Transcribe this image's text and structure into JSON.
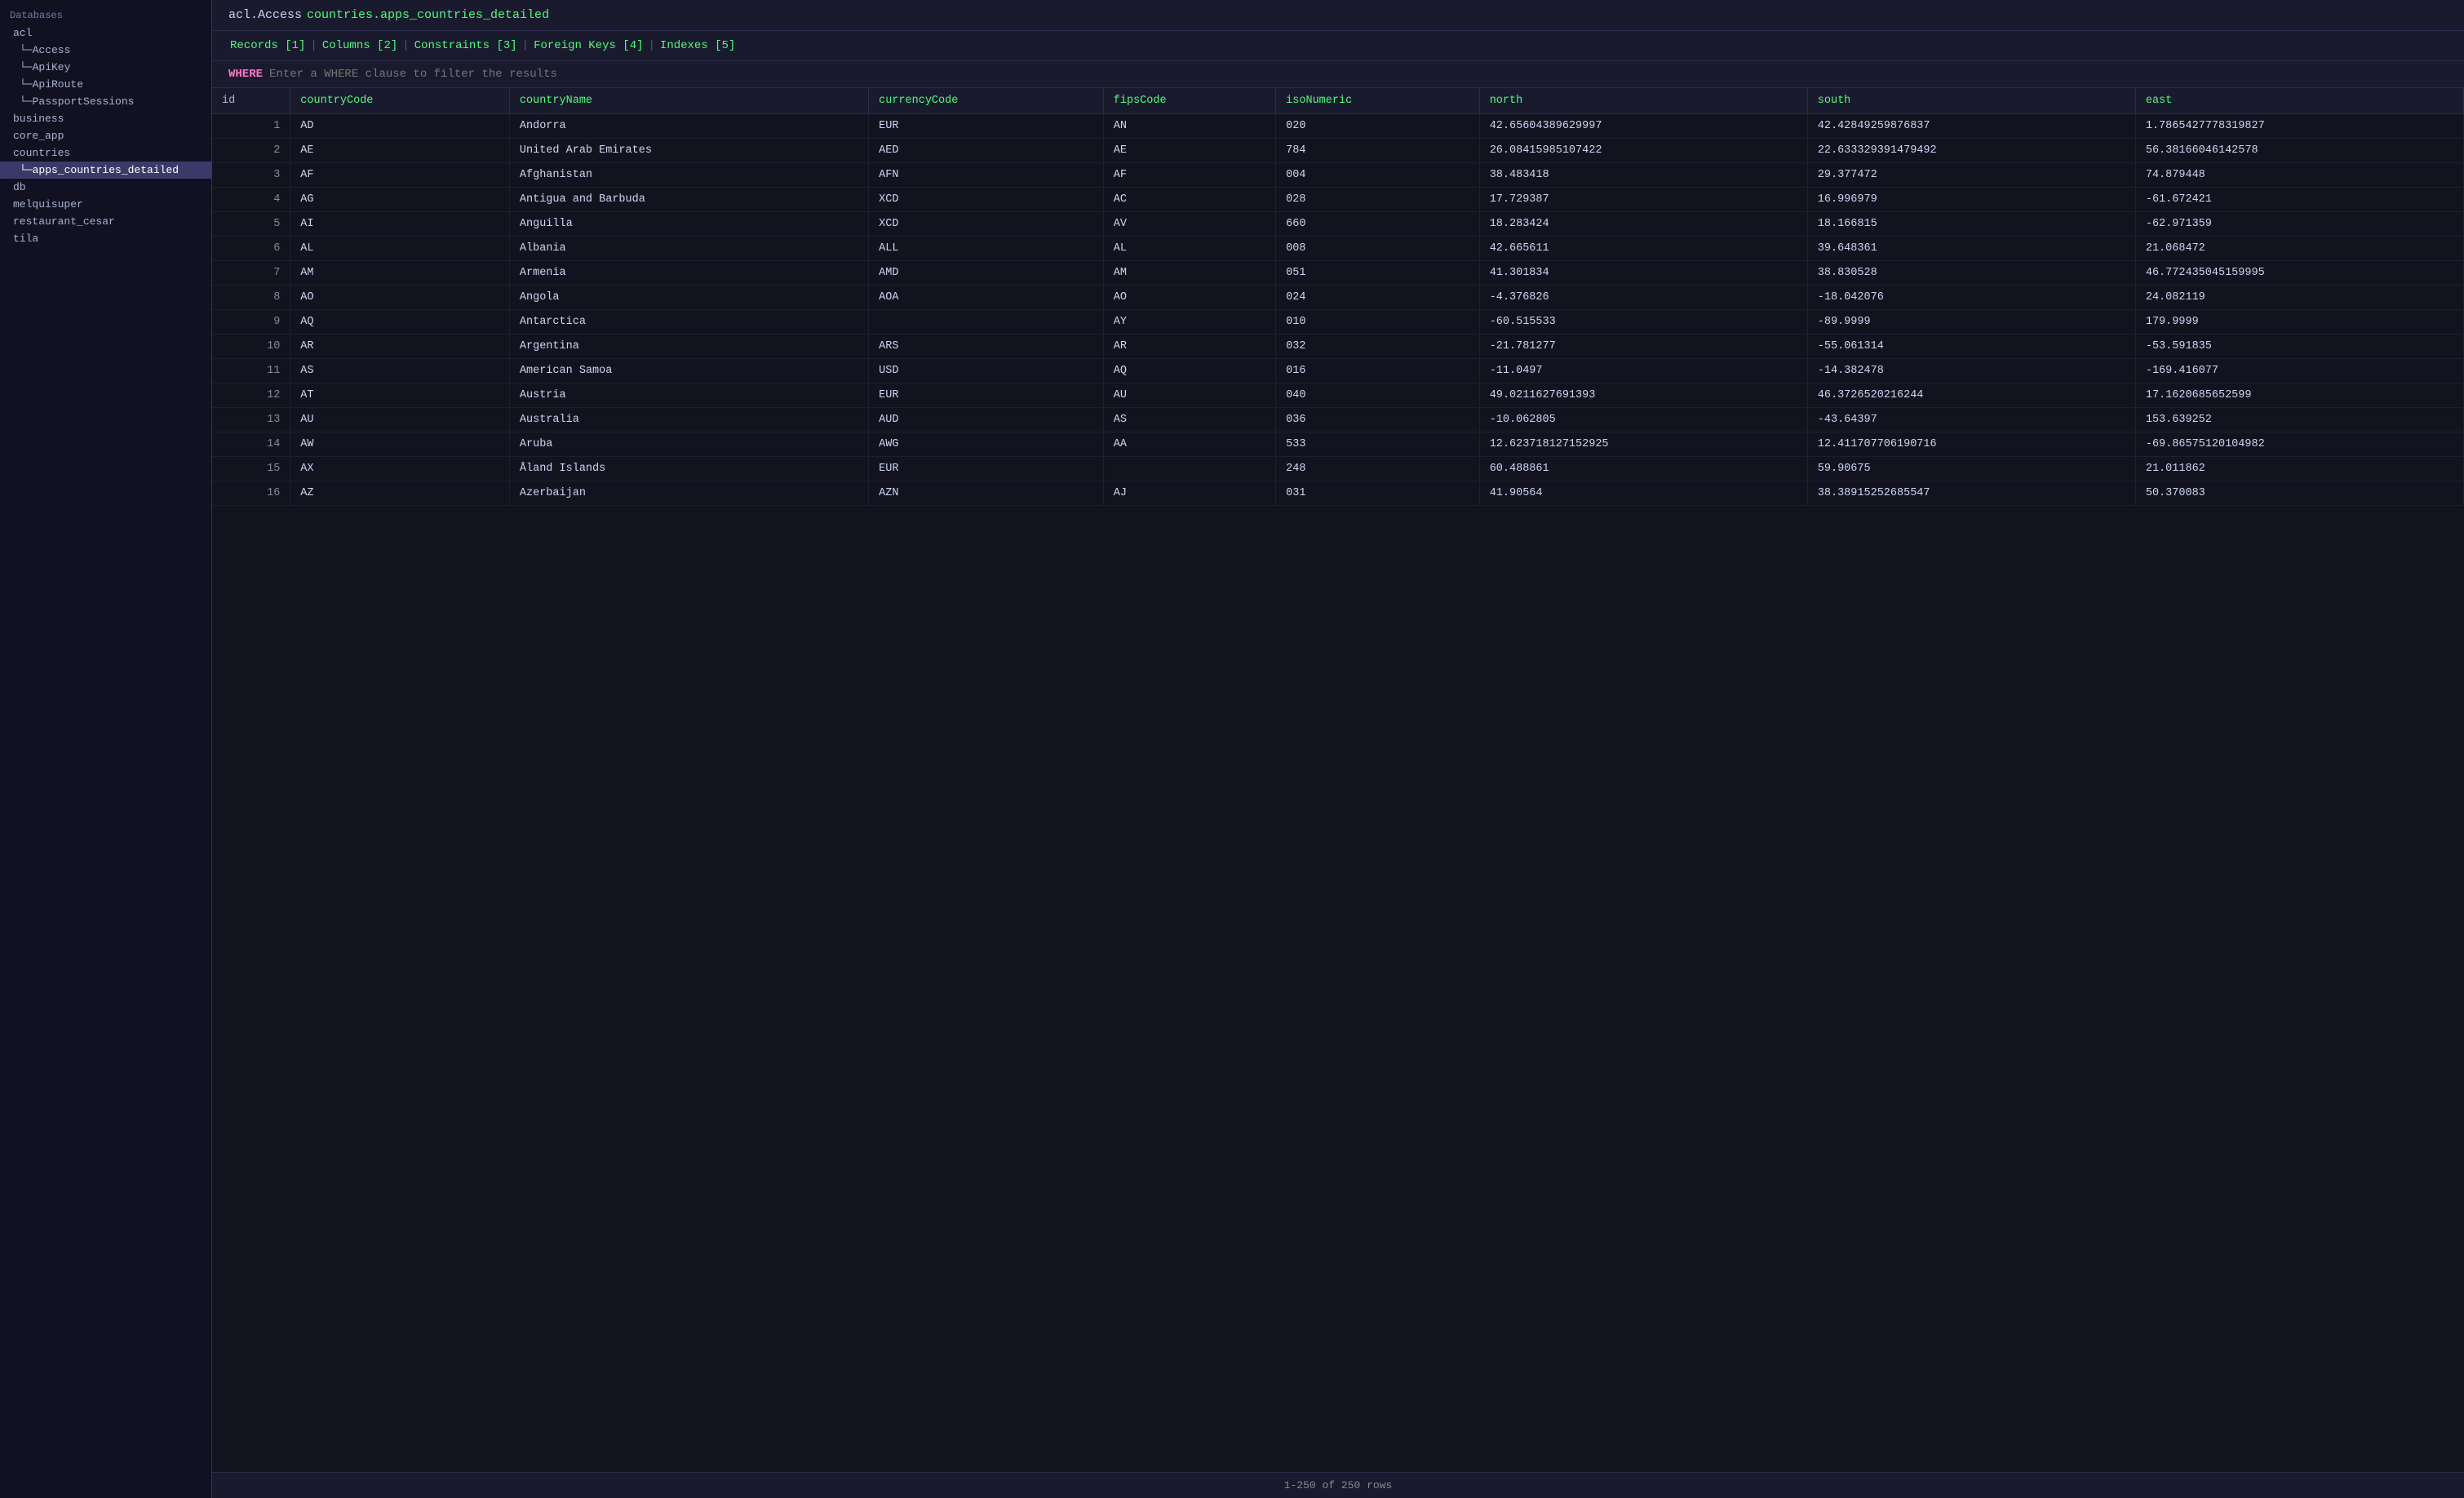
{
  "sidebar": {
    "title": "Databases",
    "items": [
      {
        "label": "acl",
        "level": 0,
        "selected": false
      },
      {
        "label": "Access",
        "level": 1,
        "selected": false
      },
      {
        "label": "ApiKey",
        "level": 1,
        "selected": false
      },
      {
        "label": "ApiRoute",
        "level": 1,
        "selected": false
      },
      {
        "label": "PassportSessions",
        "level": 1,
        "selected": false
      },
      {
        "label": "business",
        "level": 0,
        "selected": false
      },
      {
        "label": "core_app",
        "level": 0,
        "selected": false
      },
      {
        "label": "countries",
        "level": 0,
        "selected": false
      },
      {
        "label": "apps_countries_detailed",
        "level": 1,
        "selected": true
      },
      {
        "label": "db",
        "level": 0,
        "selected": false
      },
      {
        "label": "melquisuper",
        "level": 0,
        "selected": false
      },
      {
        "label": "restaurant_cesar",
        "level": 0,
        "selected": false
      },
      {
        "label": "tila",
        "level": 0,
        "selected": false
      }
    ]
  },
  "breadcrumb": {
    "schema": "acl.Access",
    "table": "countries.apps_countries_detailed"
  },
  "tabs": [
    {
      "label": "Records",
      "number": "1",
      "active": true
    },
    {
      "label": "Columns",
      "number": "2",
      "active": false
    },
    {
      "label": "Constraints",
      "number": "3",
      "active": false
    },
    {
      "label": "Foreign Keys",
      "number": "4",
      "active": false
    },
    {
      "label": "Indexes",
      "number": "5",
      "active": false
    }
  ],
  "filter": {
    "keyword": "WHERE",
    "placeholder": "Enter a WHERE clause to filter the results"
  },
  "table": {
    "columns": [
      "id",
      "countryCode",
      "countryName",
      "currencyCode",
      "fipsCode",
      "isoNumeric",
      "north",
      "south",
      "east"
    ],
    "rows": [
      [
        1,
        "AD",
        "Andorra",
        "EUR",
        "AN",
        "020",
        "42.65604389629997",
        "42.42849259876837",
        "1.7865427778319827"
      ],
      [
        2,
        "AE",
        "United Arab Emirates",
        "AED",
        "AE",
        "784",
        "26.08415985107422",
        "22.633329391479492",
        "56.38166046142578"
      ],
      [
        3,
        "AF",
        "Afghanistan",
        "AFN",
        "AF",
        "004",
        "38.483418",
        "29.377472",
        "74.879448"
      ],
      [
        4,
        "AG",
        "Antigua and Barbuda",
        "XCD",
        "AC",
        "028",
        "17.729387",
        "16.996979",
        "-61.672421"
      ],
      [
        5,
        "AI",
        "Anguilla",
        "XCD",
        "AV",
        "660",
        "18.283424",
        "18.166815",
        "-62.971359"
      ],
      [
        6,
        "AL",
        "Albania",
        "ALL",
        "AL",
        "008",
        "42.665611",
        "39.648361",
        "21.068472"
      ],
      [
        7,
        "AM",
        "Armenia",
        "AMD",
        "AM",
        "051",
        "41.301834",
        "38.830528",
        "46.772435045159995"
      ],
      [
        8,
        "AO",
        "Angola",
        "AOA",
        "AO",
        "024",
        "-4.376826",
        "-18.042076",
        "24.082119"
      ],
      [
        9,
        "AQ",
        "Antarctica",
        "",
        "AY",
        "010",
        "-60.515533",
        "-89.9999",
        "179.9999"
      ],
      [
        10,
        "AR",
        "Argentina",
        "ARS",
        "AR",
        "032",
        "-21.781277",
        "-55.061314",
        "-53.591835"
      ],
      [
        11,
        "AS",
        "American Samoa",
        "USD",
        "AQ",
        "016",
        "-11.0497",
        "-14.382478",
        "-169.416077"
      ],
      [
        12,
        "AT",
        "Austria",
        "EUR",
        "AU",
        "040",
        "49.0211627691393",
        "46.3726520216244",
        "17.1620685652599"
      ],
      [
        13,
        "AU",
        "Australia",
        "AUD",
        "AS",
        "036",
        "-10.062805",
        "-43.64397",
        "153.639252"
      ],
      [
        14,
        "AW",
        "Aruba",
        "AWG",
        "AA",
        "533",
        "12.623718127152925",
        "12.411707706190716",
        "-69.86575120104982"
      ],
      [
        15,
        "AX",
        "Åland Islands",
        "EUR",
        "",
        "248",
        "60.488861",
        "59.90675",
        "21.011862"
      ],
      [
        16,
        "AZ",
        "Azerbaijan",
        "AZN",
        "AJ",
        "031",
        "41.90564",
        "38.38915252685547",
        "50.370083"
      ]
    ]
  },
  "footer": {
    "pagination": "1-250 of 250 rows"
  }
}
